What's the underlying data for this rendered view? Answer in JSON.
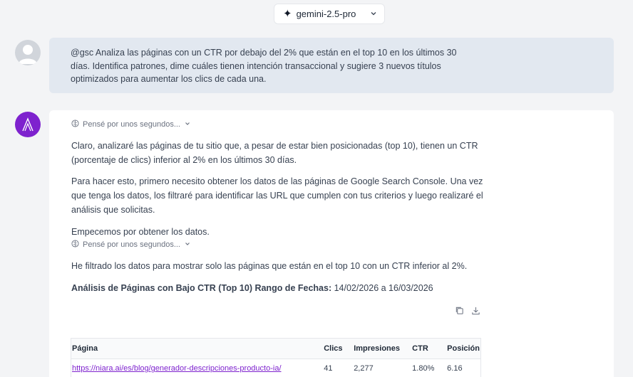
{
  "header": {
    "model_label": "gemini-2.5-pro"
  },
  "user_message": {
    "text": "@gsc Analiza las páginas con un CTR por debajo del 2% que están en el top 10 en los últimos 30 días. Identifica patrones, dime cuáles tienen intención transaccional y sugiere 3 nuevos títulos optimizados para aumentar los clics de cada una."
  },
  "assistant": {
    "thought_1": "Pensé por unos segundos...",
    "para_1": "Claro, analizaré las páginas de tu sitio que, a pesar de estar bien posicionadas (top 10), tienen un CTR (porcentaje de clics) inferior al 2% en los últimos 30 días.",
    "para_2": "Para hacer esto, primero necesito obtener los datos de las páginas de Google Search Console. Una vez que tenga los datos, los filtraré para identificar las URL que cumplen con tus criterios y luego realizaré el análisis que solicitas.",
    "para_3": "Empecemos por obtener los datos.",
    "thought_2": "Pensé por unos segundos...",
    "para_4": "He filtrado los datos para mostrar solo las páginas que están en el top 10 con un CTR inferior al 2%.",
    "summary_label": "Análisis de Páginas con Bajo CTR (Top 10) Rango de Fechas:",
    "summary_value": " 14/02/2026 a 16/03/2026"
  },
  "table": {
    "headers": [
      "Página",
      "Clics",
      "Impresiones",
      "CTR",
      "Posición"
    ],
    "rows": [
      {
        "page": "https://niara.ai/es/blog/generador-descripciones-producto-ia/",
        "clicks": "41",
        "impressions": "2,277",
        "ctr": "1.80%",
        "position": "6.16"
      }
    ]
  },
  "icons": {
    "model": "sparkle-icon",
    "dropdown": "chevron-down-icon",
    "thought": "brain-icon",
    "copy": "copy-icon",
    "download": "download-icon"
  },
  "colors": {
    "accent": "#7e22ce",
    "user_bubble": "#e2e8f0",
    "background": "#f3f4f6"
  }
}
